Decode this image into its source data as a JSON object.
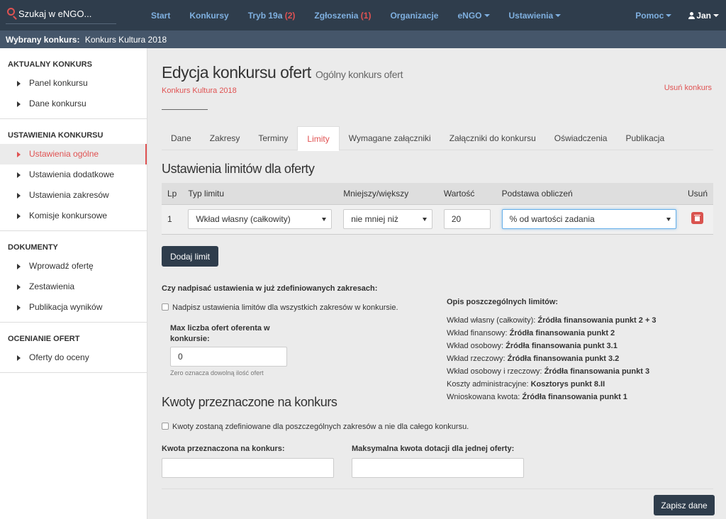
{
  "topnav": {
    "search_label": "Szukaj w eNGO...",
    "links": [
      {
        "label": "Start"
      },
      {
        "label": "Konkursy"
      },
      {
        "label": "Tryb 19a",
        "count": "(2)"
      },
      {
        "label": "Zgłoszenia",
        "count": "(1)"
      },
      {
        "label": "Organizacje"
      },
      {
        "label": "eNGO"
      },
      {
        "label": "Ustawienia"
      }
    ],
    "help_label": "Pomoc",
    "user_label": "Jan"
  },
  "selected_bar": {
    "prefix": "Wybrany konkurs:",
    "value": "Konkurs Kultura 2018"
  },
  "sidebar": {
    "sections": [
      {
        "title": "AKTUALNY KONKURS",
        "items": [
          "Panel konkursu",
          "Dane konkursu"
        ]
      },
      {
        "title": "USTAWIENIA KONKURSU",
        "items": [
          "Ustawienia ogólne",
          "Ustawienia dodatkowe",
          "Ustawienia zakresów",
          "Komisje konkursowe"
        ]
      },
      {
        "title": "DOKUMENTY",
        "items": [
          "Wprowadź ofertę",
          "Zestawienia",
          "Publikacja wyników"
        ]
      },
      {
        "title": "OCENIANIE OFERT",
        "items": [
          "Oferty do oceny"
        ]
      }
    ],
    "active_item": "Ustawienia ogólne"
  },
  "page": {
    "title": "Edycja konkursu ofert",
    "subtitle": "Ogólny konkurs ofert",
    "contest_name": "Konkurs Kultura 2018",
    "delete_label": "Usuń konkurs"
  },
  "tabs": [
    "Dane",
    "Zakresy",
    "Terminy",
    "Limity",
    "Wymagane załączniki",
    "Załączniki do konkursu",
    "Oświadczenia",
    "Publikacja"
  ],
  "active_tab": "Limity",
  "limits": {
    "heading": "Ustawienia limitów dla oferty",
    "columns": [
      "Lp",
      "Typ limitu",
      "Mniejszy/większy",
      "Wartość",
      "Podstawa obliczeń",
      "Usuń"
    ],
    "rows": [
      {
        "lp": "1",
        "type": "Wkład własny (całkowity)",
        "comparison": "nie mniej niż",
        "value": "20",
        "basis": "% od wartości zadania"
      }
    ],
    "add_button": "Dodaj limit"
  },
  "overwrite": {
    "question": "Czy nadpisać ustawienia w już zdefiniowanych zakresach:",
    "checkbox_label": "Nadpisz ustawienia limitów dla wszystkich zakresów w konkursie.",
    "max_label": "Max liczba ofert oferenta w konkursie:",
    "max_value": "0",
    "max_hint": "Zero oznacza dowolną ilość ofert"
  },
  "descriptions": {
    "title": "Opis poszczególnych limitów:",
    "items": [
      {
        "name": "Wkład własny (całkowity):",
        "source": "Źródła finansowania punkt 2 + 3"
      },
      {
        "name": "Wkład finansowy:",
        "source": "Źródła finansowania punkt 2"
      },
      {
        "name": "Wkład osobowy:",
        "source": "Źródła finansowania punkt 3.1"
      },
      {
        "name": "Wkład rzeczowy:",
        "source": "Źródła finansowania punkt 3.2"
      },
      {
        "name": "Wkład osobowy i rzeczowy:",
        "source": "Źródła finansowania punkt 3"
      },
      {
        "name": "Koszty administracyjne:",
        "source": "Kosztorys punkt 8.II"
      },
      {
        "name": "Wnioskowana kwota:",
        "source": "Źródła finansowania punkt 1"
      }
    ]
  },
  "amounts": {
    "heading": "Kwoty przeznaczone na konkurs",
    "checkbox_label": "Kwoty zostaną zdefiniowane dla poszczególnych zakresów a nie dla całego konkursu.",
    "total_label": "Kwota przeznaczona na konkurs:",
    "total_value": "",
    "max_label": "Maksymalna kwota dotacji dla jednej oferty:",
    "max_value": ""
  },
  "save_button": "Zapisz dane"
}
